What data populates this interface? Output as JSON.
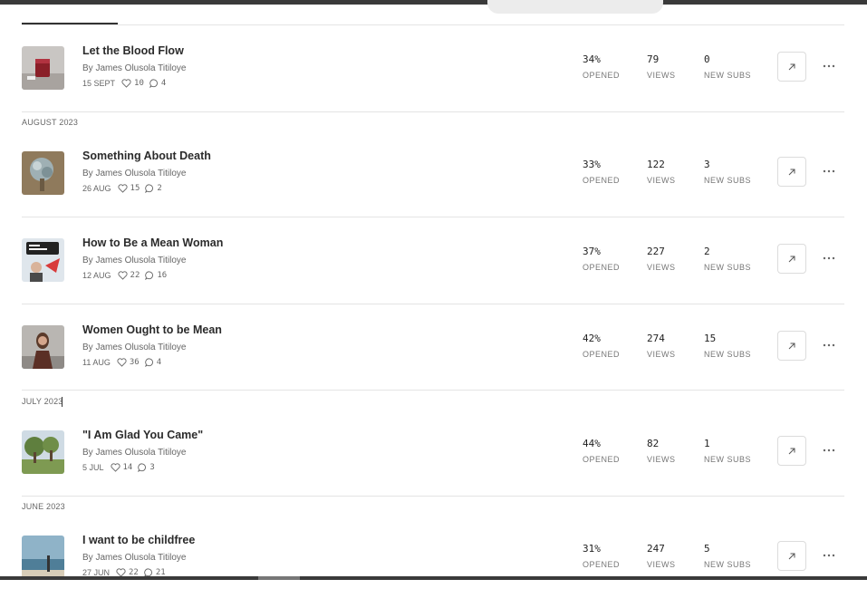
{
  "sections": {
    "aug": "AUGUST 2023",
    "jul": "JULY 2023",
    "jun": "JUNE 2023"
  },
  "labels": {
    "opened": "OPENED",
    "views": "VIEWS",
    "new_subs": "NEW SUBS"
  },
  "posts": [
    {
      "title": "Let the Blood Flow",
      "author": "By James Olusola Titiloye",
      "date": "15 SEPT",
      "likes": "10",
      "comments": "4",
      "opened": "34%",
      "views": "79",
      "new_subs": "0"
    },
    {
      "title": "Something About Death",
      "author": "By James Olusola Titiloye",
      "date": "26 AUG",
      "likes": "15",
      "comments": "2",
      "opened": "33%",
      "views": "122",
      "new_subs": "3"
    },
    {
      "title": "How to Be a Mean Woman",
      "author": "By James Olusola Titiloye",
      "date": "12 AUG",
      "likes": "22",
      "comments": "16",
      "opened": "37%",
      "views": "227",
      "new_subs": "2"
    },
    {
      "title": "Women Ought to be Mean",
      "author": "By James Olusola Titiloye",
      "date": "11 AUG",
      "likes": "36",
      "comments": "4",
      "opened": "42%",
      "views": "274",
      "new_subs": "15"
    },
    {
      "title": "\"I Am Glad You Came\"",
      "author": "By James Olusola Titiloye",
      "date": "5 JUL",
      "likes": "14",
      "comments": "3",
      "opened": "44%",
      "views": "82",
      "new_subs": "1"
    },
    {
      "title": "I want to be childfree",
      "author": "By James Olusola Titiloye",
      "date": "27 JUN",
      "likes": "22",
      "comments": "21",
      "opened": "31%",
      "views": "247",
      "new_subs": "5"
    }
  ],
  "icons": {
    "like": "heart-icon",
    "comment": "comment-icon",
    "open": "arrow-up-right-icon",
    "more": "ellipsis-icon"
  }
}
